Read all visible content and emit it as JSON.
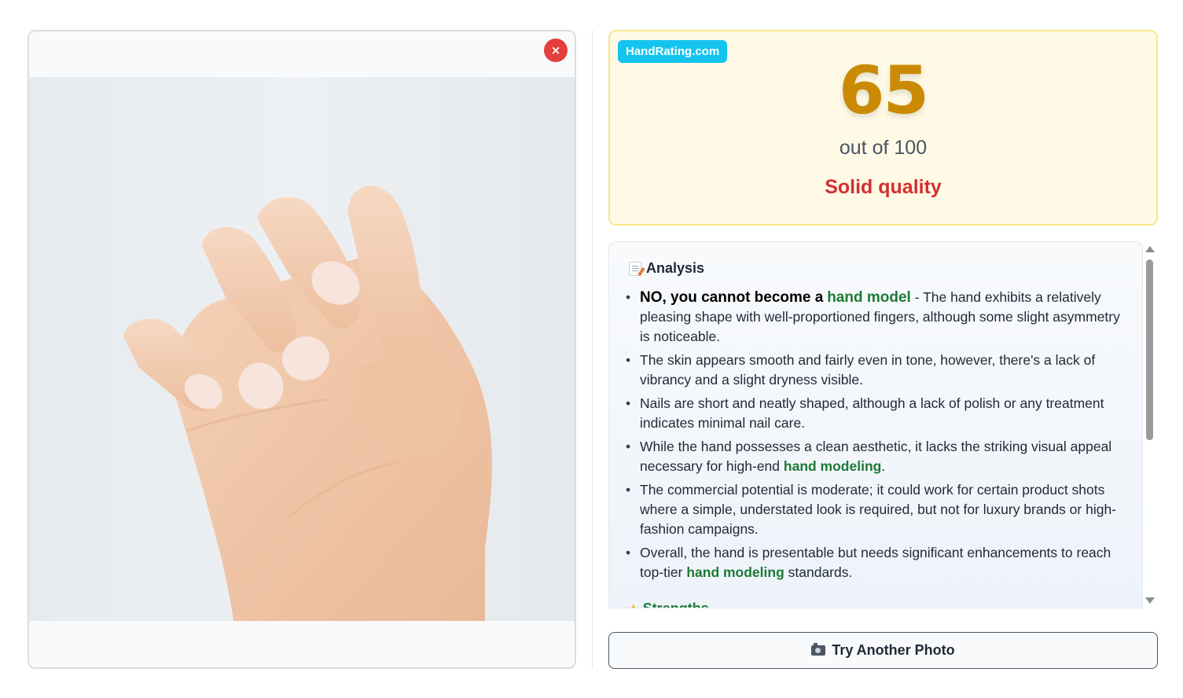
{
  "image_panel": {
    "close_label": "×",
    "photo_alt": "hand-photo"
  },
  "score": {
    "site": "HandRating.com",
    "value": "65",
    "out_of": "out of 100",
    "label": "Solid quality",
    "colors": {
      "score": "#ca8a04",
      "label": "#d32f2f",
      "badge": "#14c4ee"
    }
  },
  "analysis": {
    "icon": "memo-icon",
    "heading": "Analysis",
    "points": [
      {
        "verdict": "NO, you cannot become a",
        "verdict_link": "hand model",
        "text": " - The hand exhibits a relatively pleasing shape with well-proportioned fingers, although some slight asymmetry is noticeable."
      },
      {
        "text": "The skin appears smooth and fairly even in tone, however, there's a lack of vibrancy and a slight dryness visible."
      },
      {
        "text": "Nails are short and neatly shaped, although a lack of polish or any treatment indicates minimal nail care."
      },
      {
        "text": "While the hand possesses a clean aesthetic, it lacks the striking visual appeal necessary for high-end ",
        "link": "hand modeling",
        "after": "."
      },
      {
        "text": "The commercial potential is moderate; it could work for certain product shots where a simple, understated look is required, but not for luxury brands or high-fashion campaigns."
      },
      {
        "text": "Overall, the hand is presentable but needs significant enhancements to reach top-tier ",
        "link": "hand modeling",
        "after": " standards."
      }
    ],
    "strengths_icon": "sparkles-icon",
    "strengths_heading": "Strengths"
  },
  "actions": {
    "try_another_icon": "camera-icon",
    "try_another": "Try Another Photo"
  }
}
